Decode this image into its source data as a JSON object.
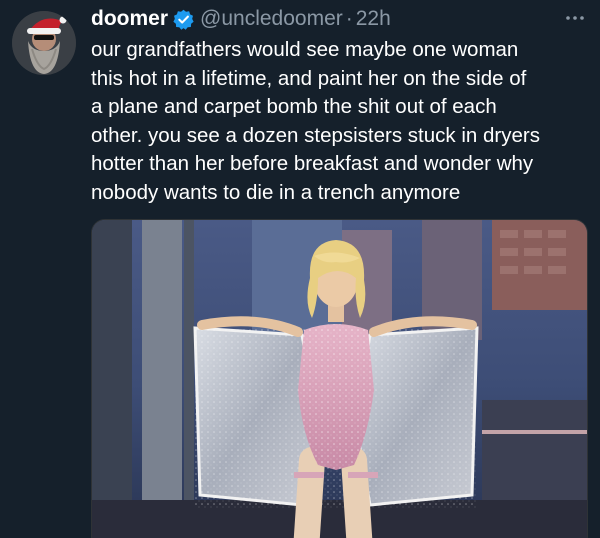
{
  "author": {
    "display_name": "doomer",
    "handle": "@uncledoomer",
    "separator": "·",
    "time": "22h",
    "avatar_icon": "avatar-bearded-santa-hat",
    "verified_icon": "verified-badge-icon"
  },
  "tweet": {
    "text_lines": [
      "our grandfathers would see maybe one woman",
      "this hot in a lifetime, and paint her on the side of",
      "a plane and carpet bomb the shit out of each",
      "other. you see a dozen stepsisters stuck in dryers",
      "hotter than her before breakfast and wonder why",
      "nobody wants to die in a trench anymore"
    ]
  },
  "media": {
    "type": "photo",
    "icon": "photo-performer-on-stage"
  },
  "colors": {
    "background": "#15202b",
    "text": "#ffffff",
    "secondary_text": "#8b98a5",
    "verified": "#1d9bf0"
  }
}
